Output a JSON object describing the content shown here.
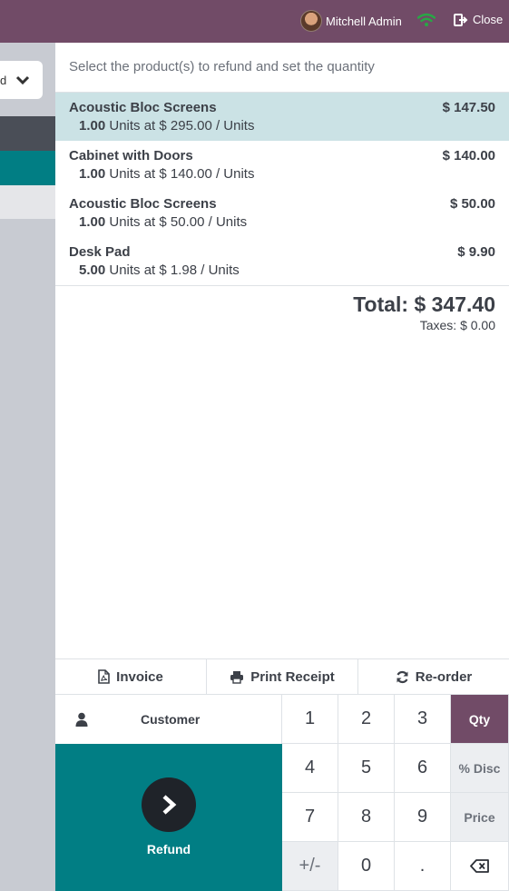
{
  "topbar": {
    "user_name": "Mitchell Admin",
    "close_label": "Close"
  },
  "left": {
    "select_fragment": "d"
  },
  "panel": {
    "instruction": "Select the product(s) to refund and set the quantity",
    "lines": [
      {
        "name": "Acoustic Bloc Screens",
        "price": "$ 147.50",
        "qty": "1.00",
        "detail": "Units at $ 295.00 / Units",
        "selected": true
      },
      {
        "name": "Cabinet with Doors",
        "price": "$ 140.00",
        "qty": "1.00",
        "detail": "Units at $ 140.00 / Units",
        "selected": false
      },
      {
        "name": "Acoustic Bloc Screens",
        "price": "$ 50.00",
        "qty": "1.00",
        "detail": "Units at $ 50.00 / Units",
        "selected": false
      },
      {
        "name": "Desk Pad",
        "price": "$ 9.90",
        "qty": "5.00",
        "detail": "Units at $ 1.98 / Units",
        "selected": false
      }
    ],
    "total": "Total: $ 347.40",
    "taxes": "Taxes: $ 0.00"
  },
  "actions": {
    "invoice": "Invoice",
    "print_receipt": "Print Receipt",
    "reorder": "Re-order"
  },
  "controls": {
    "customer": "Customer",
    "refund": "Refund"
  },
  "numpad": {
    "k1": "1",
    "k2": "2",
    "k3": "3",
    "qty": "Qty",
    "k4": "4",
    "k5": "5",
    "k6": "6",
    "disc": "% Disc",
    "k7": "7",
    "k8": "8",
    "k9": "9",
    "price": "Price",
    "plusminus": "+/-",
    "k0": "0",
    "dot": ".",
    "active_mode": "Qty"
  },
  "colors": {
    "brand": "#714b67",
    "accent": "#017e84",
    "selected_line": "#cbe2e5"
  }
}
